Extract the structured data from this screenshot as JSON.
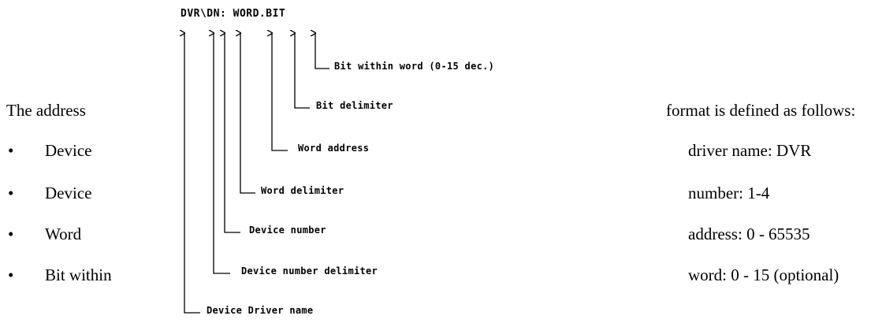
{
  "diagram": {
    "format_string": "DVR\\DN: WORD.BIT",
    "callouts": [
      "Bit within word (0-15 dec.)",
      "Bit delimiter",
      "Word address",
      "Word delimiter",
      "Device number",
      "Device number delimiter",
      "Device Driver name"
    ]
  },
  "text": {
    "intro_left": "The address",
    "intro_right": "format is defined as follows:",
    "bullet_char": "•",
    "items": [
      {
        "left": "Device",
        "right": "driver name: DVR"
      },
      {
        "left": "Device",
        "right": "number: 1-4"
      },
      {
        "left": "Word",
        "right": "address: 0 - 65535"
      },
      {
        "left": "Bit within",
        "right": "word: 0 - 15 (optional)"
      }
    ]
  }
}
